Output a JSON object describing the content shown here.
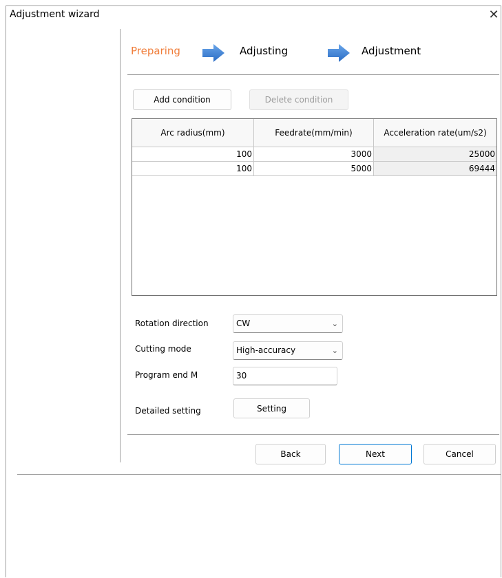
{
  "window": {
    "title": "Adjustment wizard",
    "close_glyph": "✕"
  },
  "steps": [
    {
      "label": "Preparing",
      "active": true
    },
    {
      "label": "Adjusting",
      "active": false
    },
    {
      "label": "Adjustment",
      "active": false
    }
  ],
  "toolbar": {
    "add_label": "Add condition",
    "delete_label": "Delete condition"
  },
  "table": {
    "columns": [
      "Arc radius(mm)",
      "Feedrate(mm/min)",
      "Acceleration rate(um/s2)"
    ],
    "rows": [
      [
        "100",
        "3000",
        "25000"
      ],
      [
        "100",
        "5000",
        "69444"
      ]
    ]
  },
  "form": {
    "rotation_label": "Rotation direction",
    "rotation_value": "CW",
    "cutting_label": "Cutting mode",
    "cutting_value": "High-accuracy",
    "program_end_label": "Program end M",
    "program_end_value": "30",
    "detailed_label": "Detailed setting",
    "setting_button": "Setting"
  },
  "footer": {
    "back": "Back",
    "next": "Next",
    "cancel": "Cancel"
  },
  "colors": {
    "active_step": "#f07d3a",
    "arrow": "#3b7fd4",
    "default_button_border": "#0078d4"
  }
}
